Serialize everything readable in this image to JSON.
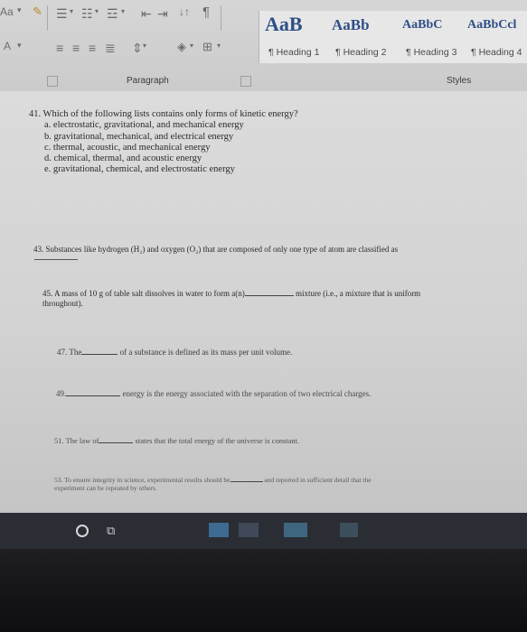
{
  "ribbon": {
    "font_group": {
      "aa_label": "Aa",
      "highlight_label": "A"
    },
    "paragraph_group": {
      "label": "Paragraph"
    },
    "styles_group": {
      "label": "Styles",
      "items": [
        {
          "sample": "AaB",
          "name": "Heading 1"
        },
        {
          "sample": "AaBb",
          "name": "Heading 2"
        },
        {
          "sample": "AaBbC",
          "name": "Heading 3"
        },
        {
          "sample": "AaBbCcl",
          "name": "Heading 4"
        }
      ]
    }
  },
  "document": {
    "q41": {
      "question": "41. Which of the following lists contains only forms of kinetic energy?",
      "options": [
        "a. electrostatic, gravitational, and mechanical energy",
        "b. gravitational, mechanical, and electrical energy",
        "c. thermal, acoustic, and mechanical energy",
        "d. chemical, thermal, and acoustic energy",
        "e. gravitational, chemical, and electrostatic energy"
      ]
    },
    "q43": {
      "text": "43. Substances like hydrogen (H₂) and oxygen (O₂) that are composed of only one type of atom are classified as"
    },
    "q45": {
      "part1": "45. A mass of 10 g of table salt dissolves in water to form a(n)",
      "part2": "mixture (i.e., a mixture that is uniform",
      "part3": "throughout)."
    },
    "q47": {
      "part1": "47. The",
      "part2": "of a substance is defined as its mass per unit volume."
    },
    "q49": {
      "part1": "49.",
      "part2": "energy is the energy associated with the separation of two electrical charges."
    },
    "q51": {
      "part1": "51. The law of",
      "part2": "states that the total energy of the universe is constant."
    },
    "q53": {
      "part1": "53. To ensure integrity in science, experimental results should be",
      "part2": "and reported in sufficient detail that the",
      "part3": "experiment can be repeated by others."
    }
  },
  "colors": {
    "style_blue": "#2d4f86",
    "ribbon_bg": "#d0d0d0",
    "taskbar": "#2a2d34"
  },
  "taskbar": {
    "icons": [
      "start-circle-icon",
      "task-view-icon",
      "browser-icon",
      "store-icon",
      "app-icon"
    ]
  }
}
